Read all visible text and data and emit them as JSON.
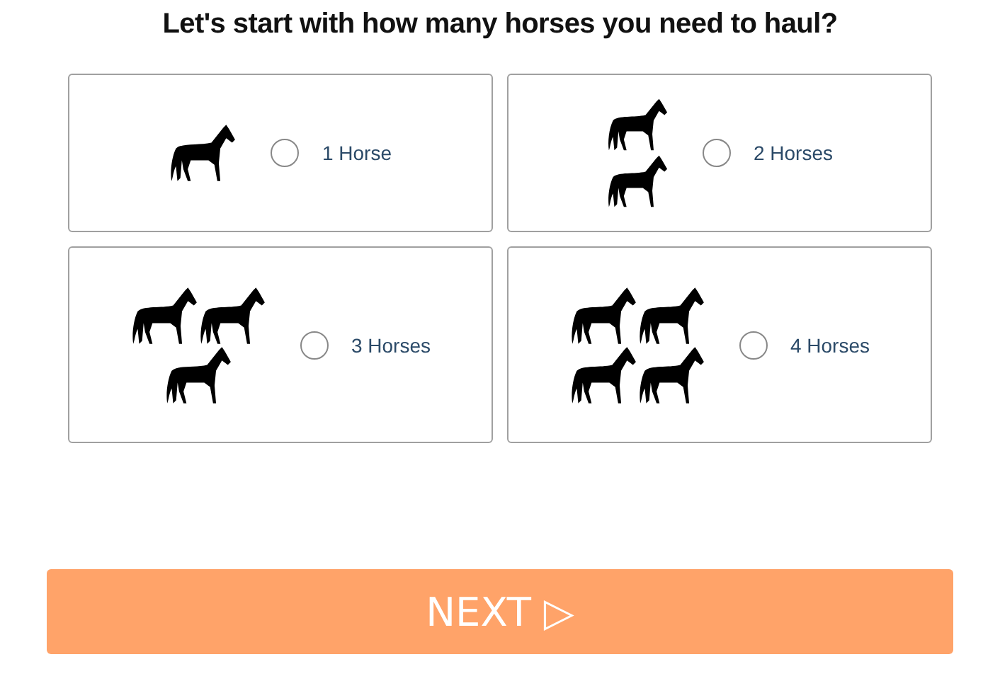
{
  "question": "Let's start with how many horses you need to haul?",
  "options": [
    {
      "label": "1 Horse",
      "kind": "single",
      "selected": false
    },
    {
      "label": "2 Horses",
      "kind": "pair",
      "selected": false
    },
    {
      "label": "3 Horses",
      "kind": "trio",
      "selected": false
    },
    {
      "label": "4 Horses",
      "kind": "quad",
      "selected": false
    }
  ],
  "next_button": {
    "label": "NEXT ▷"
  }
}
